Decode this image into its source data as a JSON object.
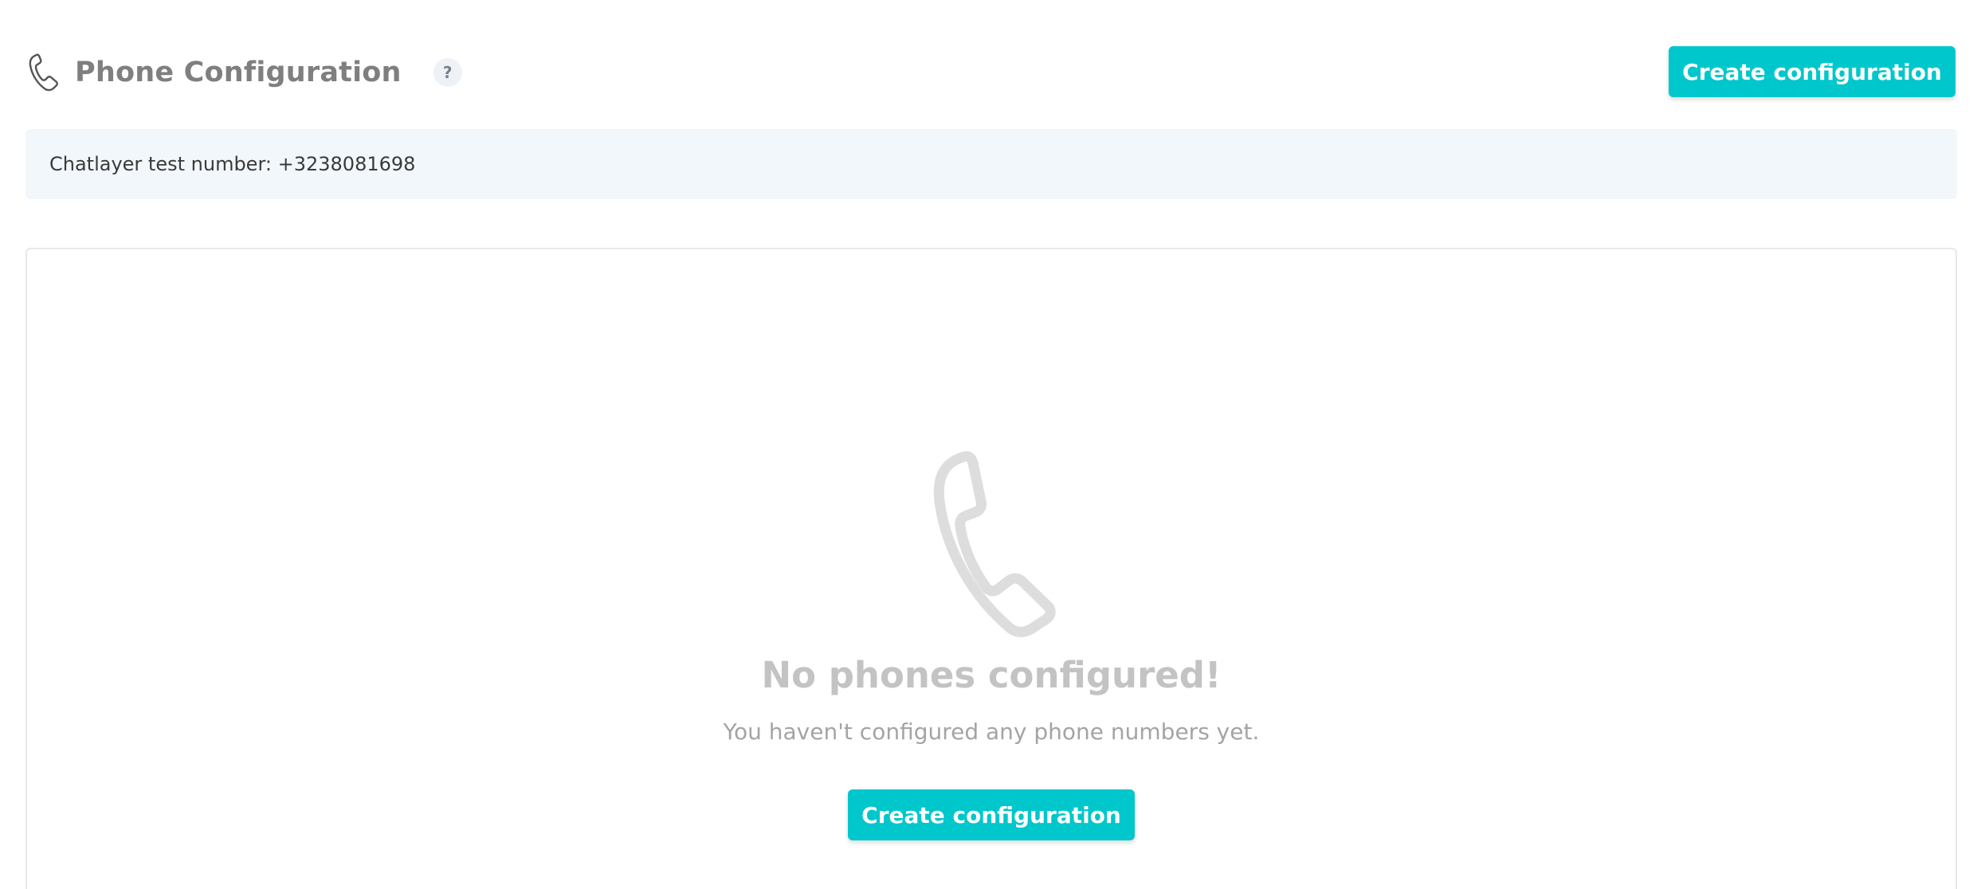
{
  "header": {
    "title": "Phone Configuration",
    "title_icon": "phone-icon",
    "help_label": "?",
    "create_button_label": "Create configuration"
  },
  "info_bar": {
    "text": "Chatlayer test number: +3238081698"
  },
  "empty_state": {
    "icon": "phone-icon",
    "title": "No phones configured!",
    "subtitle": "You haven't configured any phone numbers yet.",
    "create_button_label": "Create configuration"
  },
  "colors": {
    "accent": "#00c7cc",
    "info_background": "#f2f7fb",
    "muted_text": "#a4a4a4"
  }
}
